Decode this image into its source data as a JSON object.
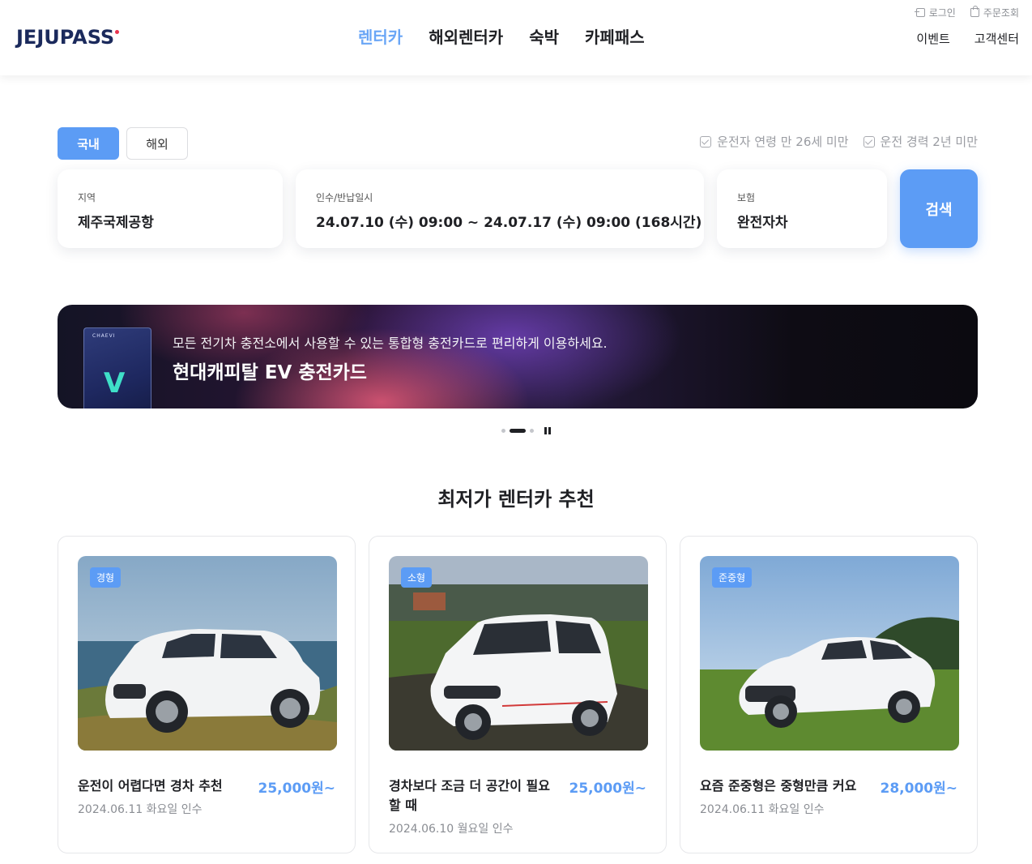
{
  "header": {
    "logo": "JEJUPASS",
    "nav": [
      "렌터카",
      "해외렌터카",
      "숙박",
      "카페패스"
    ],
    "util": {
      "login": "로그인",
      "orders": "주문조회"
    },
    "sub": {
      "events": "이벤트",
      "support": "고객센터"
    }
  },
  "search": {
    "tabs": [
      "국내",
      "해외"
    ],
    "checks": [
      "운전자 연령 만 26세 미만",
      "운전 경력 2년 미만"
    ],
    "region": {
      "label": "지역",
      "value": "제주국제공항"
    },
    "date": {
      "label": "인수/반납일시",
      "value": "24.07.10 (수) 09:00 ~ 24.07.17 (수) 09:00 (168시간)"
    },
    "insurance": {
      "label": "보험",
      "value": "완전자차"
    },
    "button": "검색"
  },
  "banner": {
    "subtitle": "모든 전기차 충전소에서 사용할 수 있는 통합형 충전카드로 편리하게 이용하세요.",
    "title": "현대캐피탈 EV 충전카드",
    "card_brand": "CHAEVI"
  },
  "section_title": "최저가 렌터카 추천",
  "cars": [
    {
      "badge": "경형",
      "name": "운전이 어렵다면 경차 추천",
      "price": "25,000원~",
      "date": "2024.06.11 화요일 인수"
    },
    {
      "badge": "소형",
      "name": "경차보다 조금 더 공간이 필요할 때",
      "price": "25,000원~",
      "date": "2024.06.10 월요일 인수"
    },
    {
      "badge": "준중형",
      "name": "요즘 준중형은 중형만큼 커요",
      "price": "28,000원~",
      "date": "2024.06.11 화요일 인수"
    }
  ],
  "colors": {
    "accent": "#5c9cf5",
    "nav_active": "#6aa6f6",
    "logo": "#1b2a5c"
  }
}
